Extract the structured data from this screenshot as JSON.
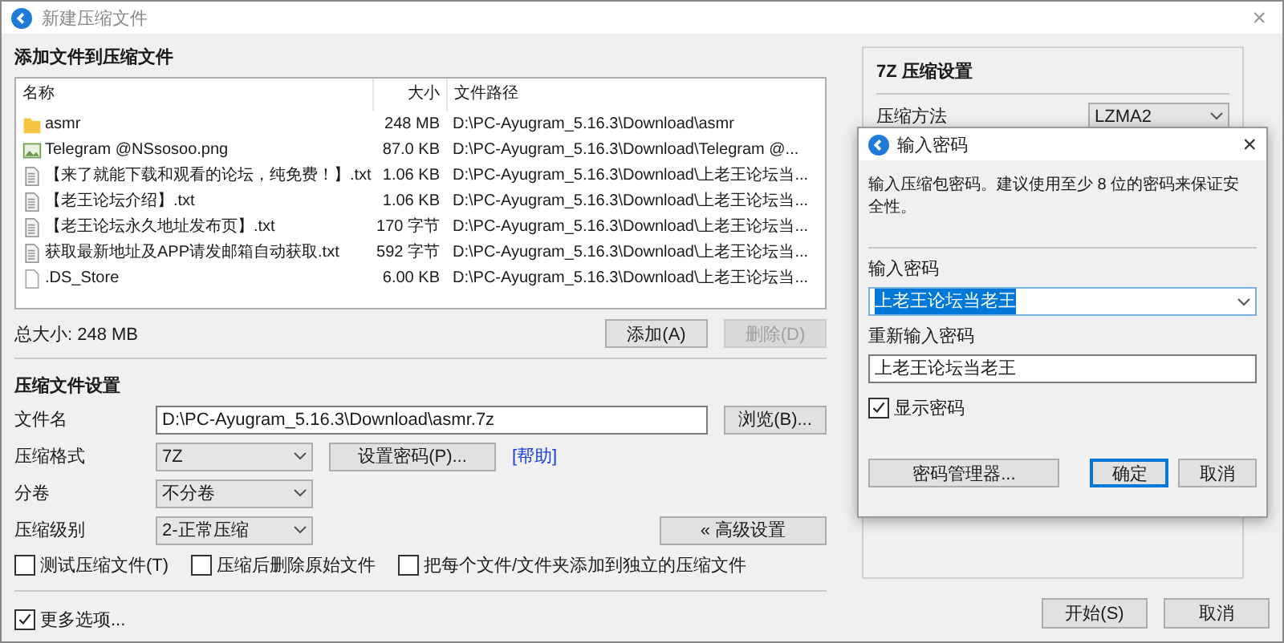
{
  "window": {
    "title": "新建压缩文件",
    "close": "×"
  },
  "files": {
    "heading": "添加文件到压缩文件",
    "columns": [
      "名称",
      "大小",
      "文件路径"
    ],
    "rows": [
      {
        "kind": "folder",
        "name": "asmr",
        "size": "248 MB",
        "path": "D:\\PC-Ayugram_5.16.3\\Download\\asmr"
      },
      {
        "kind": "image",
        "name": "Telegram @NSsosoo.png",
        "size": "87.0 KB",
        "path": "D:\\PC-Ayugram_5.16.3\\Download\\Telegram @..."
      },
      {
        "kind": "text",
        "name": "【来了就能下载和观看的论坛，纯免费！】.txt",
        "size": "1.06 KB",
        "path": "D:\\PC-Ayugram_5.16.3\\Download\\上老王论坛当..."
      },
      {
        "kind": "text",
        "name": "【老王论坛介绍】.txt",
        "size": "1.06 KB",
        "path": "D:\\PC-Ayugram_5.16.3\\Download\\上老王论坛当..."
      },
      {
        "kind": "text",
        "name": "【老王论坛永久地址发布页】.txt",
        "size": "170 字节",
        "path": "D:\\PC-Ayugram_5.16.3\\Download\\上老王论坛当..."
      },
      {
        "kind": "text",
        "name": "获取最新地址及APP请发邮箱自动获取.txt",
        "size": "592 字节",
        "path": "D:\\PC-Ayugram_5.16.3\\Download\\上老王论坛当..."
      },
      {
        "kind": "file",
        "name": ".DS_Store",
        "size": "6.00 KB",
        "path": "D:\\PC-Ayugram_5.16.3\\Download\\上老王论坛当..."
      }
    ],
    "total": "总大小: 248 MB",
    "buttons": [
      {
        "label": "添加(A)",
        "disabled": false
      },
      {
        "label": "删除(D)",
        "disabled": true
      }
    ]
  },
  "settings": {
    "heading": "压缩文件设置",
    "filename": {
      "label": "文件名",
      "value": "D:\\PC-Ayugram_5.16.3\\Download\\asmr.7z",
      "button": "浏览(B)..."
    },
    "format": {
      "label": "压缩格式",
      "value": "7Z",
      "button": "设置密码(P)...",
      "link": "[帮助]"
    },
    "split": {
      "label": "分卷",
      "value": "不分卷"
    },
    "level": {
      "label": "压缩级别",
      "value": "2-正常压缩",
      "button": "« 高级设置"
    },
    "options": [
      {
        "label": "测试压缩文件(T)",
        "checked": false
      },
      {
        "label": "压缩后删除原始文件",
        "checked": false
      },
      {
        "label": "把每个文件/文件夹添加到独立的压缩文件",
        "checked": false
      }
    ],
    "more": {
      "label": "更多选项...",
      "checked": true
    }
  },
  "advanced": {
    "heading": "7Z 压缩设置",
    "method_label": "压缩方法",
    "method_value": "LZMA2"
  },
  "actions": [
    "开始(S)",
    "取消"
  ],
  "dialog": {
    "title": "输入密码",
    "close": "×",
    "message": "输入压缩包密码。建议使用至少 8 位的密码来保证安全性。",
    "password_label": "输入密码",
    "password": {
      "value": "上老王论坛当老王",
      "selected": true
    },
    "confirm_label": "重新输入密码",
    "confirm": "上老王论坛当老王",
    "show_password": {
      "label": "显示密码",
      "checked": true
    },
    "buttons": [
      {
        "label": "密码管理器...",
        "default": false
      },
      {
        "label": "确定",
        "default": true
      },
      {
        "label": "取消",
        "default": false
      }
    ]
  }
}
